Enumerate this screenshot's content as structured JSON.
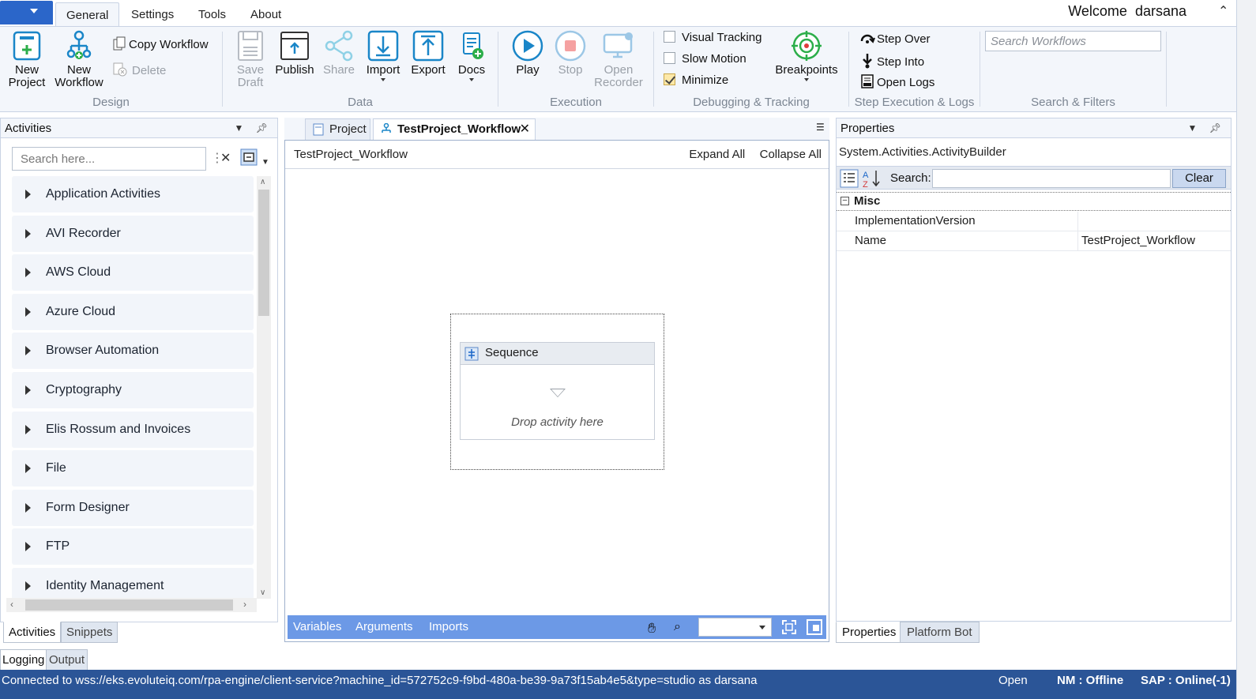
{
  "menu": {
    "tabs": [
      "General",
      "Settings",
      "Tools",
      "About"
    ],
    "active": "General",
    "welcome": "Welcome  darsana"
  },
  "ribbon": {
    "design": {
      "new_project": [
        "New",
        "Project"
      ],
      "new_workflow": [
        "New",
        "Workflow"
      ],
      "copy_workflow": "Copy Workflow",
      "delete": "Delete",
      "label": "Design"
    },
    "data": {
      "save_draft": [
        "Save",
        "Draft"
      ],
      "publish": "Publish",
      "share": "Share",
      "import": "Import",
      "export": "Export",
      "docs": "Docs",
      "label": "Data"
    },
    "execution": {
      "play": "Play",
      "stop": "Stop",
      "open_recorder": [
        "Open",
        "Recorder"
      ],
      "label": "Execution"
    },
    "debugging": {
      "visual_tracking": "Visual Tracking",
      "slow_motion": "Slow Motion",
      "minimize": "Minimize",
      "minimize_checked": true,
      "breakpoints": "Breakpoints",
      "label": "Debugging & Tracking"
    },
    "step": {
      "step_over": "Step Over",
      "step_into": "Step Into",
      "open_logs": "Open Logs",
      "label": "Step Execution & Logs"
    },
    "search": {
      "placeholder": "Search Workflows",
      "label": "Search & Filters"
    }
  },
  "activities": {
    "title": "Activities",
    "search_placeholder": "Search here...",
    "items": [
      "Application Activities",
      "AVI Recorder",
      "AWS Cloud",
      "Azure Cloud",
      "Browser Automation",
      "Cryptography",
      "Elis Rossum and Invoices",
      "File",
      "Form Designer",
      "FTP",
      "Identity Management"
    ],
    "tabs": [
      "Activities",
      "Snippets"
    ]
  },
  "designer": {
    "tabs": [
      "Project",
      "TestProject_Workflow"
    ],
    "breadcrumb": "TestProject_Workflow",
    "expand_all": "Expand All",
    "collapse_all": "Collapse All",
    "sequence_title": "Sequence",
    "drop_hint": "Drop activity here",
    "footer": [
      "Variables",
      "Arguments",
      "Imports"
    ]
  },
  "properties": {
    "title": "Properties",
    "type_name": "System.Activities.ActivityBuilder",
    "search_label": "Search:",
    "clear": "Clear",
    "category": "Misc",
    "rows": [
      {
        "name": "ImplementationVersion",
        "value": ""
      },
      {
        "name": "Name",
        "value": "TestProject_Workflow"
      }
    ],
    "tabs": [
      "Properties",
      "Platform Bot"
    ]
  },
  "output_tabs": [
    "Logging",
    "Output"
  ],
  "status": {
    "connection": "Connected to wss://eks.evoluteiq.com/rpa-engine/client-service?machine_id=572752c9-f9bd-480a-be39-9a73f15ab4e5&type=studio as darsana",
    "state": "Open",
    "nm": "NM : Offline",
    "sap": "SAP : Online(-1)"
  },
  "colors": {
    "accent": "#2b66c9",
    "statusbar": "#2b5597",
    "designer_footer": "#6c99e6",
    "ribbon_bg": "#f3f6fb"
  }
}
